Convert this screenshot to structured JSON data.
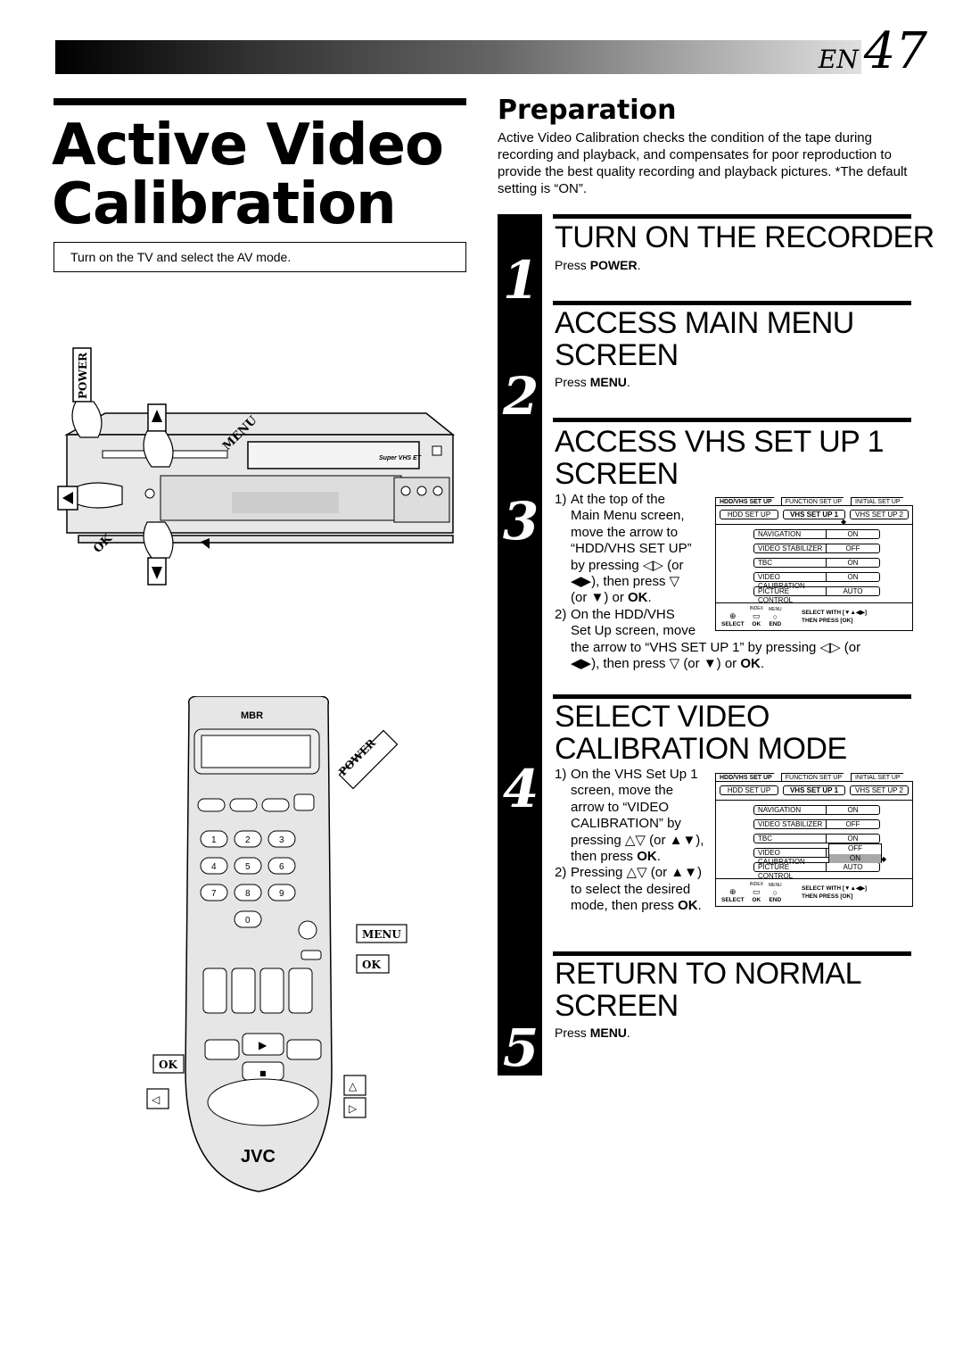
{
  "header": {
    "lang": "EN",
    "page_number": "47",
    "band_gradient": [
      "#000000",
      "#e0e0e0"
    ]
  },
  "title": {
    "line1": "Active Video",
    "line2": "Calibration"
  },
  "tv_note": "Turn on the TV and select the AV mode.",
  "preparation": {
    "heading": "Preparation",
    "body": "Active Video Calibration checks the condition of the tape during recording and playback, and compensates for poor reproduction to provide the best quality recording and playback pictures. *The default setting is “ON”."
  },
  "steps": [
    {
      "number": "1",
      "heading": "TURN ON THE RECORDER",
      "press": "Press ",
      "key": "POWER",
      "end": "."
    },
    {
      "number": "2",
      "heading_l1": "ACCESS MAIN MENU",
      "heading_l2": "SCREEN",
      "press": "Press ",
      "key": "MENU",
      "end": "."
    },
    {
      "number": "3",
      "heading_l1": "ACCESS VHS SET UP 1",
      "heading_l2": "SCREEN",
      "items": [
        {
          "n": "1)",
          "lines": [
            "At the top of the",
            "Main Menu screen,",
            "move the arrow to",
            "“HDD/VHS SET UP”",
            "by pressing ◁▷ (or",
            "◀▶), then press ▽",
            "(or ▼) or OK."
          ]
        },
        {
          "n": "2)",
          "lines": [
            "On the HDD/VHS",
            "Set Up screen, move",
            "the arrow to “VHS SET UP 1” by pressing ◁▷ (or",
            "◀▶), then press ▽ (or ▼) or OK."
          ]
        }
      ]
    },
    {
      "number": "4",
      "heading_l1": "SELECT VIDEO",
      "heading_l2": "CALIBRATION MODE",
      "items": [
        {
          "n": "1)",
          "lines": [
            "On the VHS Set Up 1",
            "screen, move the",
            "arrow to “VIDEO",
            "CALIBRATION” by",
            "pressing △▽ (or ▲▼),",
            "then press OK."
          ]
        },
        {
          "n": "2)",
          "lines": [
            "Pressing △▽ (or ▲▼)",
            "to select the desired",
            "mode, then press OK."
          ]
        }
      ]
    },
    {
      "number": "5",
      "heading_l1": "RETURN TO NORMAL",
      "heading_l2": "SCREEN",
      "press": "Press ",
      "key": "MENU",
      "end": "."
    }
  ],
  "osd": {
    "tabs": [
      "HDD/VHS SET UP",
      "FUNCTION SET UP",
      "INITIAL SET UP"
    ],
    "subtabs": [
      "HDD SET UP",
      "VHS SET UP 1",
      "VHS SET UP 2"
    ],
    "rows": [
      {
        "label": "NAVIGATION",
        "value": "ON"
      },
      {
        "label": "VIDEO STABILIZER",
        "value": "OFF"
      },
      {
        "label": "TBC",
        "value": "ON"
      },
      {
        "label": "VIDEO CALIBRATION",
        "value": "ON"
      },
      {
        "label": "PICTURE CONTROL",
        "value": "AUTO"
      }
    ],
    "footer": {
      "select": "SELECT",
      "ok": "OK",
      "end": "END",
      "index": "INDEX",
      "menu": "MENU",
      "help1": "SELECT WITH [▼▲◀▶]",
      "help2": "THEN PRESS [OK]"
    },
    "popup_options": [
      "OFF",
      "ON"
    ],
    "popup_selected": "ON"
  },
  "recorder_callouts": {
    "power": "POWER",
    "menu": "MENU",
    "ok": "OK",
    "model": "Super VHS ET"
  },
  "remote_callouts": {
    "power": "POWER",
    "menu": "MENU",
    "ok_top": "OK",
    "ok_bottom": "OK",
    "brand": "JVC",
    "logo": "MBR",
    "keypad": [
      "1",
      "2",
      "3",
      "4",
      "5",
      "6",
      "7",
      "8",
      "9",
      "0"
    ]
  }
}
